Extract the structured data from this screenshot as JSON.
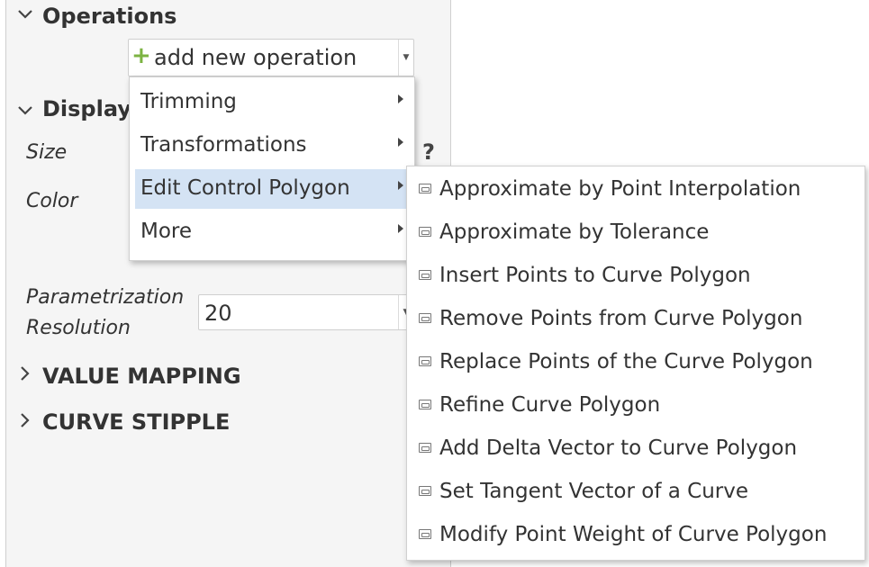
{
  "panel": {
    "operations": {
      "title": "Operations",
      "add_label": "add new operation"
    },
    "display": {
      "title": "Display",
      "size_label": "Size",
      "color_label": "Color",
      "param_label_line1": "Parametrization",
      "param_label_line2": "Resolution",
      "param_value": "20",
      "help_glyph": "?"
    },
    "value_mapping": {
      "title": "VALUE MAPPING"
    },
    "curve_stipple": {
      "title": "CURVE STIPPLE"
    }
  },
  "menu": {
    "items": [
      "Trimming",
      "Transformations",
      "Edit Control Polygon",
      "More"
    ],
    "highlighted": "Edit Control Polygon"
  },
  "submenu": {
    "items": [
      "Approximate by Point Interpolation",
      "Approximate by Tolerance",
      "Insert Points to Curve Polygon",
      "Remove Points from Curve Polygon",
      "Replace Points of the Curve Polygon",
      "Refine Curve Polygon",
      "Add Delta Vector to Curve Polygon",
      "Set Tangent Vector of a Curve",
      "Modify Point Weight of Curve Polygon"
    ]
  },
  "colors": {
    "highlight": "#d4e3f4",
    "plus": "#7cb342",
    "panel_bg": "#f5f5f5"
  }
}
